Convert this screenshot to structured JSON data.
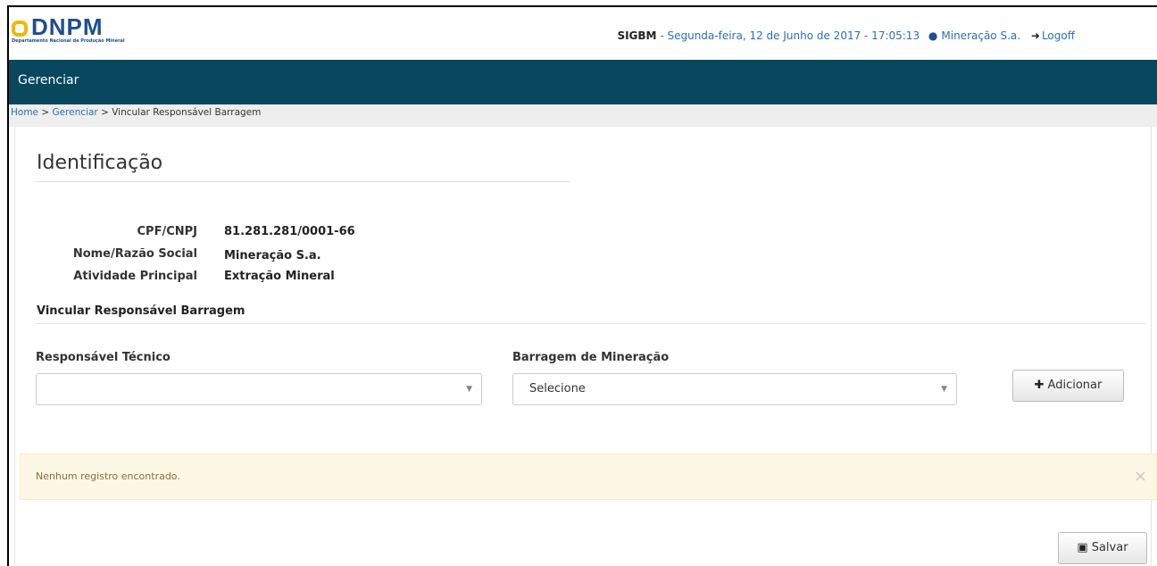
{
  "header": {
    "logo_text": "DNPM",
    "logo_subtitle": "Departamento Nacional de Produção Mineral",
    "system_name": "SIGBM",
    "datetime": "- Segunda-feira, 12 de Junho de 2017 - 17:05:13",
    "user_name": "Mineração S.a.",
    "logoff_label": "Logoff"
  },
  "nav": {
    "item": "Gerenciar"
  },
  "breadcrumb": {
    "home": "Home",
    "sep": " > ",
    "section": "Gerenciar",
    "current": "Vincular Responsável Barragem"
  },
  "page": {
    "title": "Identificação"
  },
  "info": [
    {
      "label": "CPF/CNPJ",
      "value": "81.281.281/0001-66"
    },
    {
      "label": "Nome/Razão Social",
      "value": "Mineração S.a."
    },
    {
      "label": "Atividade Principal",
      "value": "Extração Mineral"
    }
  ],
  "section": {
    "title": "Vincular Responsável Barragem"
  },
  "form": {
    "responsavel_label": "Responsável Técnico",
    "responsavel_value": "",
    "barragem_label": "Barragem de Mineração",
    "barragem_value": "Selecione",
    "add_label": "Adicionar"
  },
  "alert": {
    "message": "Nenhum registro encontrado.",
    "close": "×"
  },
  "footer": {
    "save_label": "Salvar"
  }
}
